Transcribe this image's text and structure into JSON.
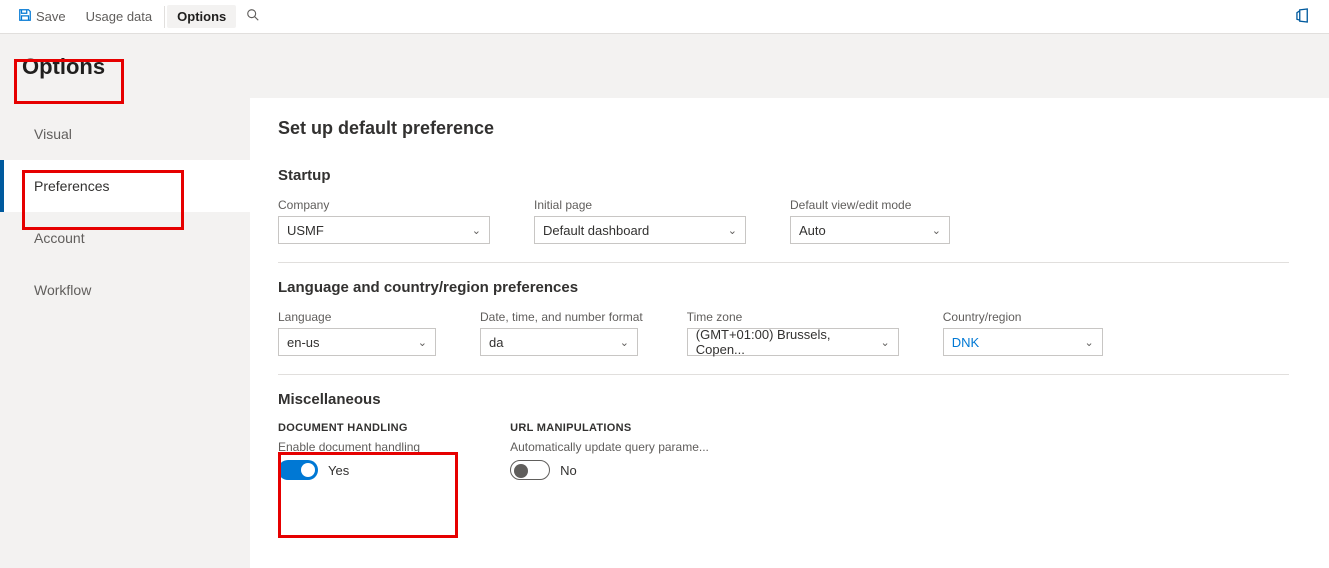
{
  "toolbar": {
    "save_label": "Save",
    "usage_data_label": "Usage data",
    "options_label": "Options"
  },
  "page": {
    "title": "Options"
  },
  "sidebar": {
    "items": [
      {
        "label": "Visual"
      },
      {
        "label": "Preferences"
      },
      {
        "label": "Account"
      },
      {
        "label": "Workflow"
      }
    ]
  },
  "content": {
    "heading": "Set up default preference",
    "startup": {
      "title": "Startup",
      "company_label": "Company",
      "company_value": "USMF",
      "initial_page_label": "Initial page",
      "initial_page_value": "Default dashboard",
      "default_mode_label": "Default view/edit mode",
      "default_mode_value": "Auto"
    },
    "lang": {
      "title": "Language and country/region preferences",
      "language_label": "Language",
      "language_value": "en-us",
      "datefmt_label": "Date, time, and number format",
      "datefmt_value": "da",
      "timezone_label": "Time zone",
      "timezone_value": "(GMT+01:00) Brussels, Copen...",
      "country_label": "Country/region",
      "country_value": "DNK"
    },
    "misc": {
      "title": "Miscellaneous",
      "doc_handling_title": "DOCUMENT HANDLING",
      "doc_handling_hint": "Enable document handling",
      "doc_handling_toggle": "Yes",
      "url_manip_title": "URL MANIPULATIONS",
      "url_manip_hint": "Automatically update query parame...",
      "url_manip_toggle": "No"
    }
  }
}
